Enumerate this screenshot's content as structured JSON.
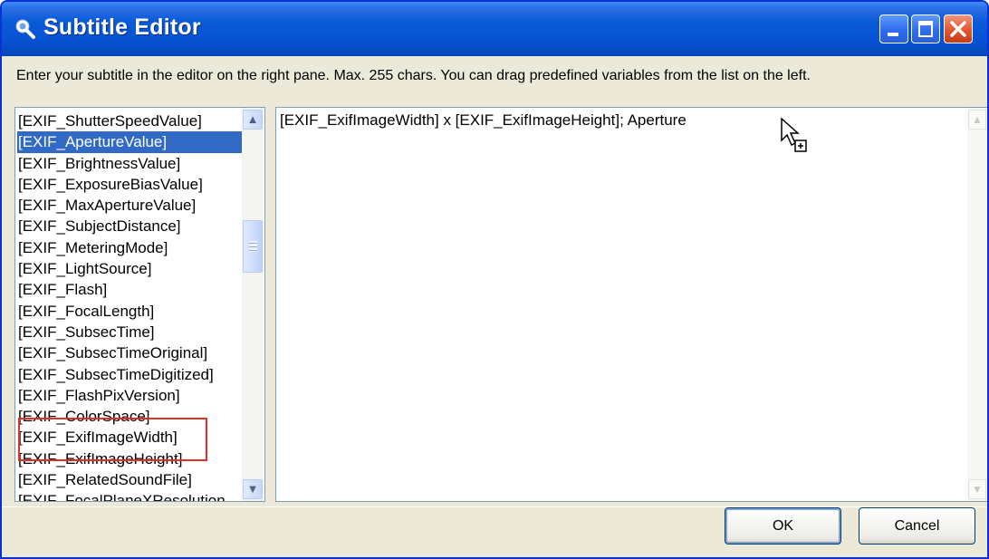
{
  "window": {
    "title": "Subtitle Editor"
  },
  "instruction": "Enter your subtitle in the editor on the right pane. Max. 255 chars. You can drag predefined variables from the list on the left.",
  "variables": {
    "items": [
      "[EXIF_ShutterSpeedValue]",
      "[EXIF_ApertureValue]",
      "[EXIF_BrightnessValue]",
      "[EXIF_ExposureBiasValue]",
      "[EXIF_MaxApertureValue]",
      "[EXIF_SubjectDistance]",
      "[EXIF_MeteringMode]",
      "[EXIF_LightSource]",
      "[EXIF_Flash]",
      "[EXIF_FocalLength]",
      "[EXIF_SubsecTime]",
      "[EXIF_SubsecTimeOriginal]",
      "[EXIF_SubsecTimeDigitized]",
      "[EXIF_FlashPixVersion]",
      "[EXIF_ColorSpace]",
      "[EXIF_ExifImageWidth]",
      "[EXIF_ExifImageHeight]",
      "[EXIF_RelatedSoundFile]",
      "[EXIF_FocalPlaneXResolution"
    ],
    "selected": "[EXIF_ApertureValue]",
    "highlighted": [
      "[EXIF_ExifImageWidth]",
      "[EXIF_ExifImageHeight]"
    ]
  },
  "editor": {
    "value": "[EXIF_ExifImageWidth] x [EXIF_ExifImageHeight]; Aperture"
  },
  "buttons": {
    "ok": "OK",
    "cancel": "Cancel"
  },
  "icons": {
    "app": "app-icon",
    "minimize": "minimize-icon",
    "maximize": "maximize-icon",
    "close": "close-icon",
    "list_up": "scroll-up-arrow-icon",
    "list_down": "scroll-down-arrow-icon",
    "cursor": "drag-copy-cursor-icon"
  },
  "colors": {
    "titlebar": "#0553d3",
    "selection": "#316ac5",
    "highlight_border": "#e0302a",
    "dialog_bg": "#ece9d8"
  }
}
